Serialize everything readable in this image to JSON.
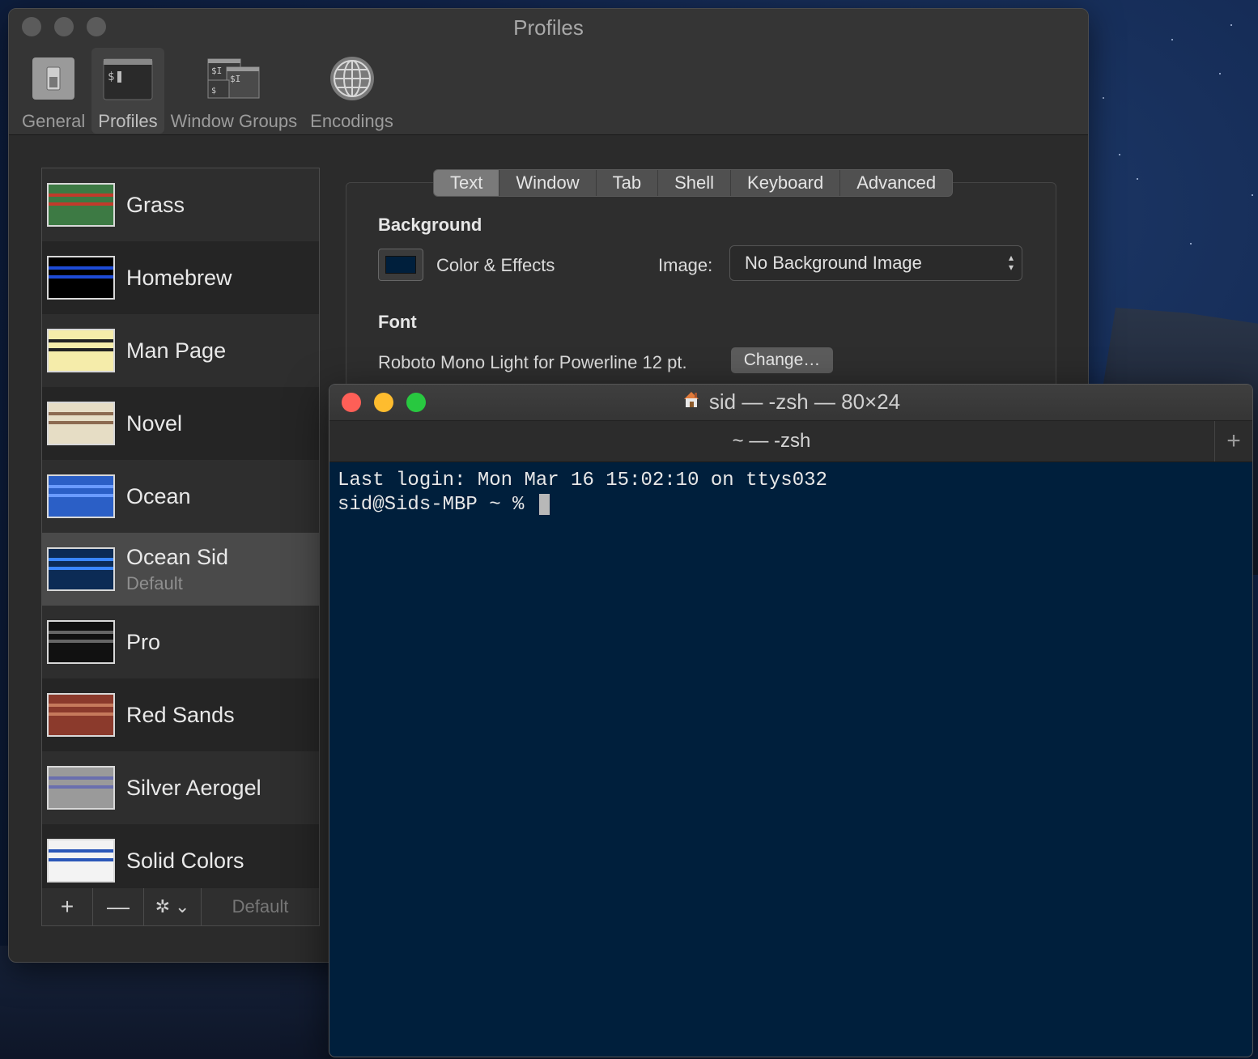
{
  "prefs": {
    "title": "Profiles",
    "toolbar": [
      {
        "label": "General",
        "icon": "switch-icon"
      },
      {
        "label": "Profiles",
        "icon": "terminal-icon",
        "selected": true
      },
      {
        "label": "Window Groups",
        "icon": "window-groups-icon"
      },
      {
        "label": "Encodings",
        "icon": "globe-icon"
      }
    ]
  },
  "profiles": [
    {
      "name": "Grass",
      "sub": "",
      "thumb_bg": "#3d7a44",
      "thumb_hl": "#c23b2b"
    },
    {
      "name": "Homebrew",
      "sub": "",
      "thumb_bg": "#000000",
      "thumb_hl": "#1d4bd6"
    },
    {
      "name": "Man Page",
      "sub": "",
      "thumb_bg": "#f5ecaa",
      "thumb_hl": "#222222"
    },
    {
      "name": "Novel",
      "sub": "",
      "thumb_bg": "#e6ddc5",
      "thumb_hl": "#8c6a50"
    },
    {
      "name": "Ocean",
      "sub": "",
      "thumb_bg": "#2b5fc6",
      "thumb_hl": "#6a9bff"
    },
    {
      "name": "Ocean Sid",
      "sub": "Default",
      "thumb_bg": "#0c2b55",
      "thumb_hl": "#3a86ff",
      "selected": true
    },
    {
      "name": "Pro",
      "sub": "",
      "thumb_bg": "#111111",
      "thumb_hl": "#666666"
    },
    {
      "name": "Red Sands",
      "sub": "",
      "thumb_bg": "#8b3a2c",
      "thumb_hl": "#c67a5c"
    },
    {
      "name": "Silver Aerogel",
      "sub": "",
      "thumb_bg": "#9a9a9a",
      "thumb_hl": "#6a6fae"
    },
    {
      "name": "Solid Colors",
      "sub": "",
      "thumb_bg": "#f3f3f3",
      "thumb_hl": "#2a57b8"
    }
  ],
  "list_footer": {
    "add": "+",
    "remove": "—",
    "gear": "✲",
    "default_label": "Default"
  },
  "settings": {
    "tabs": [
      "Text",
      "Window",
      "Tab",
      "Shell",
      "Keyboard",
      "Advanced"
    ],
    "selected_tab": "Text",
    "background_title": "Background",
    "color_effects_label": "Color & Effects",
    "image_label": "Image:",
    "image_value": "No Background Image",
    "font_title": "Font",
    "font_value": "Roboto Mono Light for Powerline 12 pt.",
    "change_button": "Change…",
    "background_color": "#001f3c"
  },
  "terminal": {
    "title": "sid — -zsh — 80×24",
    "tab_title": "~ — -zsh",
    "new_tab": "+",
    "lines": [
      "Last login: Mon Mar 16 15:02:10 on ttys032",
      "sid@Sids-MBP ~ % "
    ],
    "background": "#001f3c"
  }
}
